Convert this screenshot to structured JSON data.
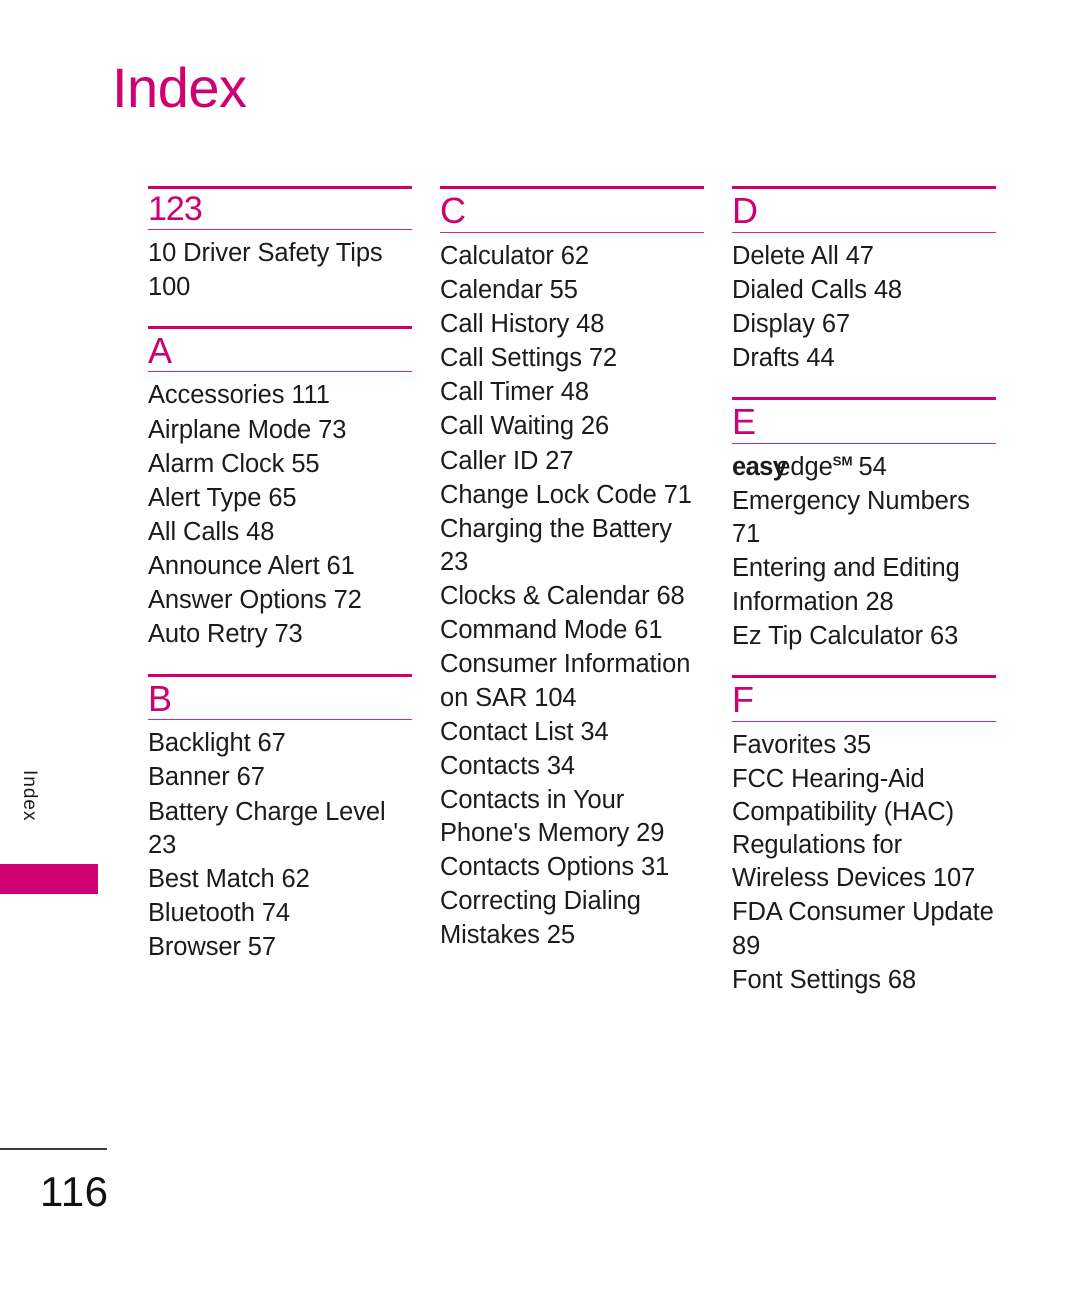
{
  "page": {
    "title": "Index",
    "side_tab_label": "Index",
    "page_number": "116",
    "accent_color": "#CE0072",
    "text_color": "#1b1b1b"
  },
  "columns": [
    {
      "sections": [
        {
          "letter": "123",
          "numeric": true,
          "entries": [
            {
              "text": "10 Driver Safety Tips 100"
            }
          ]
        },
        {
          "letter": "A",
          "numeric": false,
          "entries": [
            {
              "text": "Accessories 111"
            },
            {
              "text": "Airplane Mode 73"
            },
            {
              "text": "Alarm Clock 55"
            },
            {
              "text": "Alert Type 65"
            },
            {
              "text": "All Calls 48"
            },
            {
              "text": "Announce Alert 61"
            },
            {
              "text": "Answer Options 72"
            },
            {
              "text": "Auto Retry 73"
            }
          ]
        },
        {
          "letter": "B",
          "numeric": false,
          "entries": [
            {
              "text": "Backlight 67"
            },
            {
              "text": "Banner 67"
            },
            {
              "text": "Battery Charge Level 23"
            },
            {
              "text": "Best Match 62"
            },
            {
              "text": "Bluetooth 74"
            },
            {
              "text": "Browser 57"
            }
          ]
        }
      ]
    },
    {
      "sections": [
        {
          "letter": "C",
          "numeric": false,
          "entries": [
            {
              "text": "Calculator 62"
            },
            {
              "text": "Calendar 55"
            },
            {
              "text": "Call History 48"
            },
            {
              "text": "Call Settings 72"
            },
            {
              "text": "Call Timer 48"
            },
            {
              "text": "Call Waiting 26"
            },
            {
              "text": "Caller ID 27"
            },
            {
              "text": "Change Lock Code 71"
            },
            {
              "text": "Charging the Battery 23"
            },
            {
              "text": "Clocks & Calendar 68"
            },
            {
              "text": "Command Mode 61"
            },
            {
              "text": "Consumer Information on SAR 104"
            },
            {
              "text": "Contact List 34"
            },
            {
              "text": "Contacts 34"
            },
            {
              "text": "Contacts in Your Phone's Memory 29"
            },
            {
              "text": "Contacts Options 31"
            },
            {
              "text": "Correcting Dialing Mistakes 25"
            }
          ]
        }
      ]
    },
    {
      "sections": [
        {
          "letter": "D",
          "numeric": false,
          "entries": [
            {
              "text": "Delete All 47"
            },
            {
              "text": "Dialed Calls 48"
            },
            {
              "text": "Display 67"
            },
            {
              "text": "Drafts 44"
            }
          ]
        },
        {
          "letter": "E",
          "numeric": false,
          "entries": [
            {
              "text": "easyedge",
              "style": "easyedge",
              "brand_first": "easy",
              "brand_second": "edge",
              "superscript": "SM",
              "page_ref": "54"
            },
            {
              "text": "Emergency Numbers 71"
            },
            {
              "text": "Entering and Editing Information 28"
            },
            {
              "text": "Ez Tip Calculator 63"
            }
          ]
        },
        {
          "letter": "F",
          "numeric": false,
          "entries": [
            {
              "text": "Favorites 35"
            },
            {
              "text": "FCC Hearing-Aid Compatibility (HAC) Regulations for Wireless Devices 107"
            },
            {
              "text": "FDA Consumer Update 89"
            },
            {
              "text": "Font Settings 68"
            }
          ]
        }
      ]
    }
  ]
}
